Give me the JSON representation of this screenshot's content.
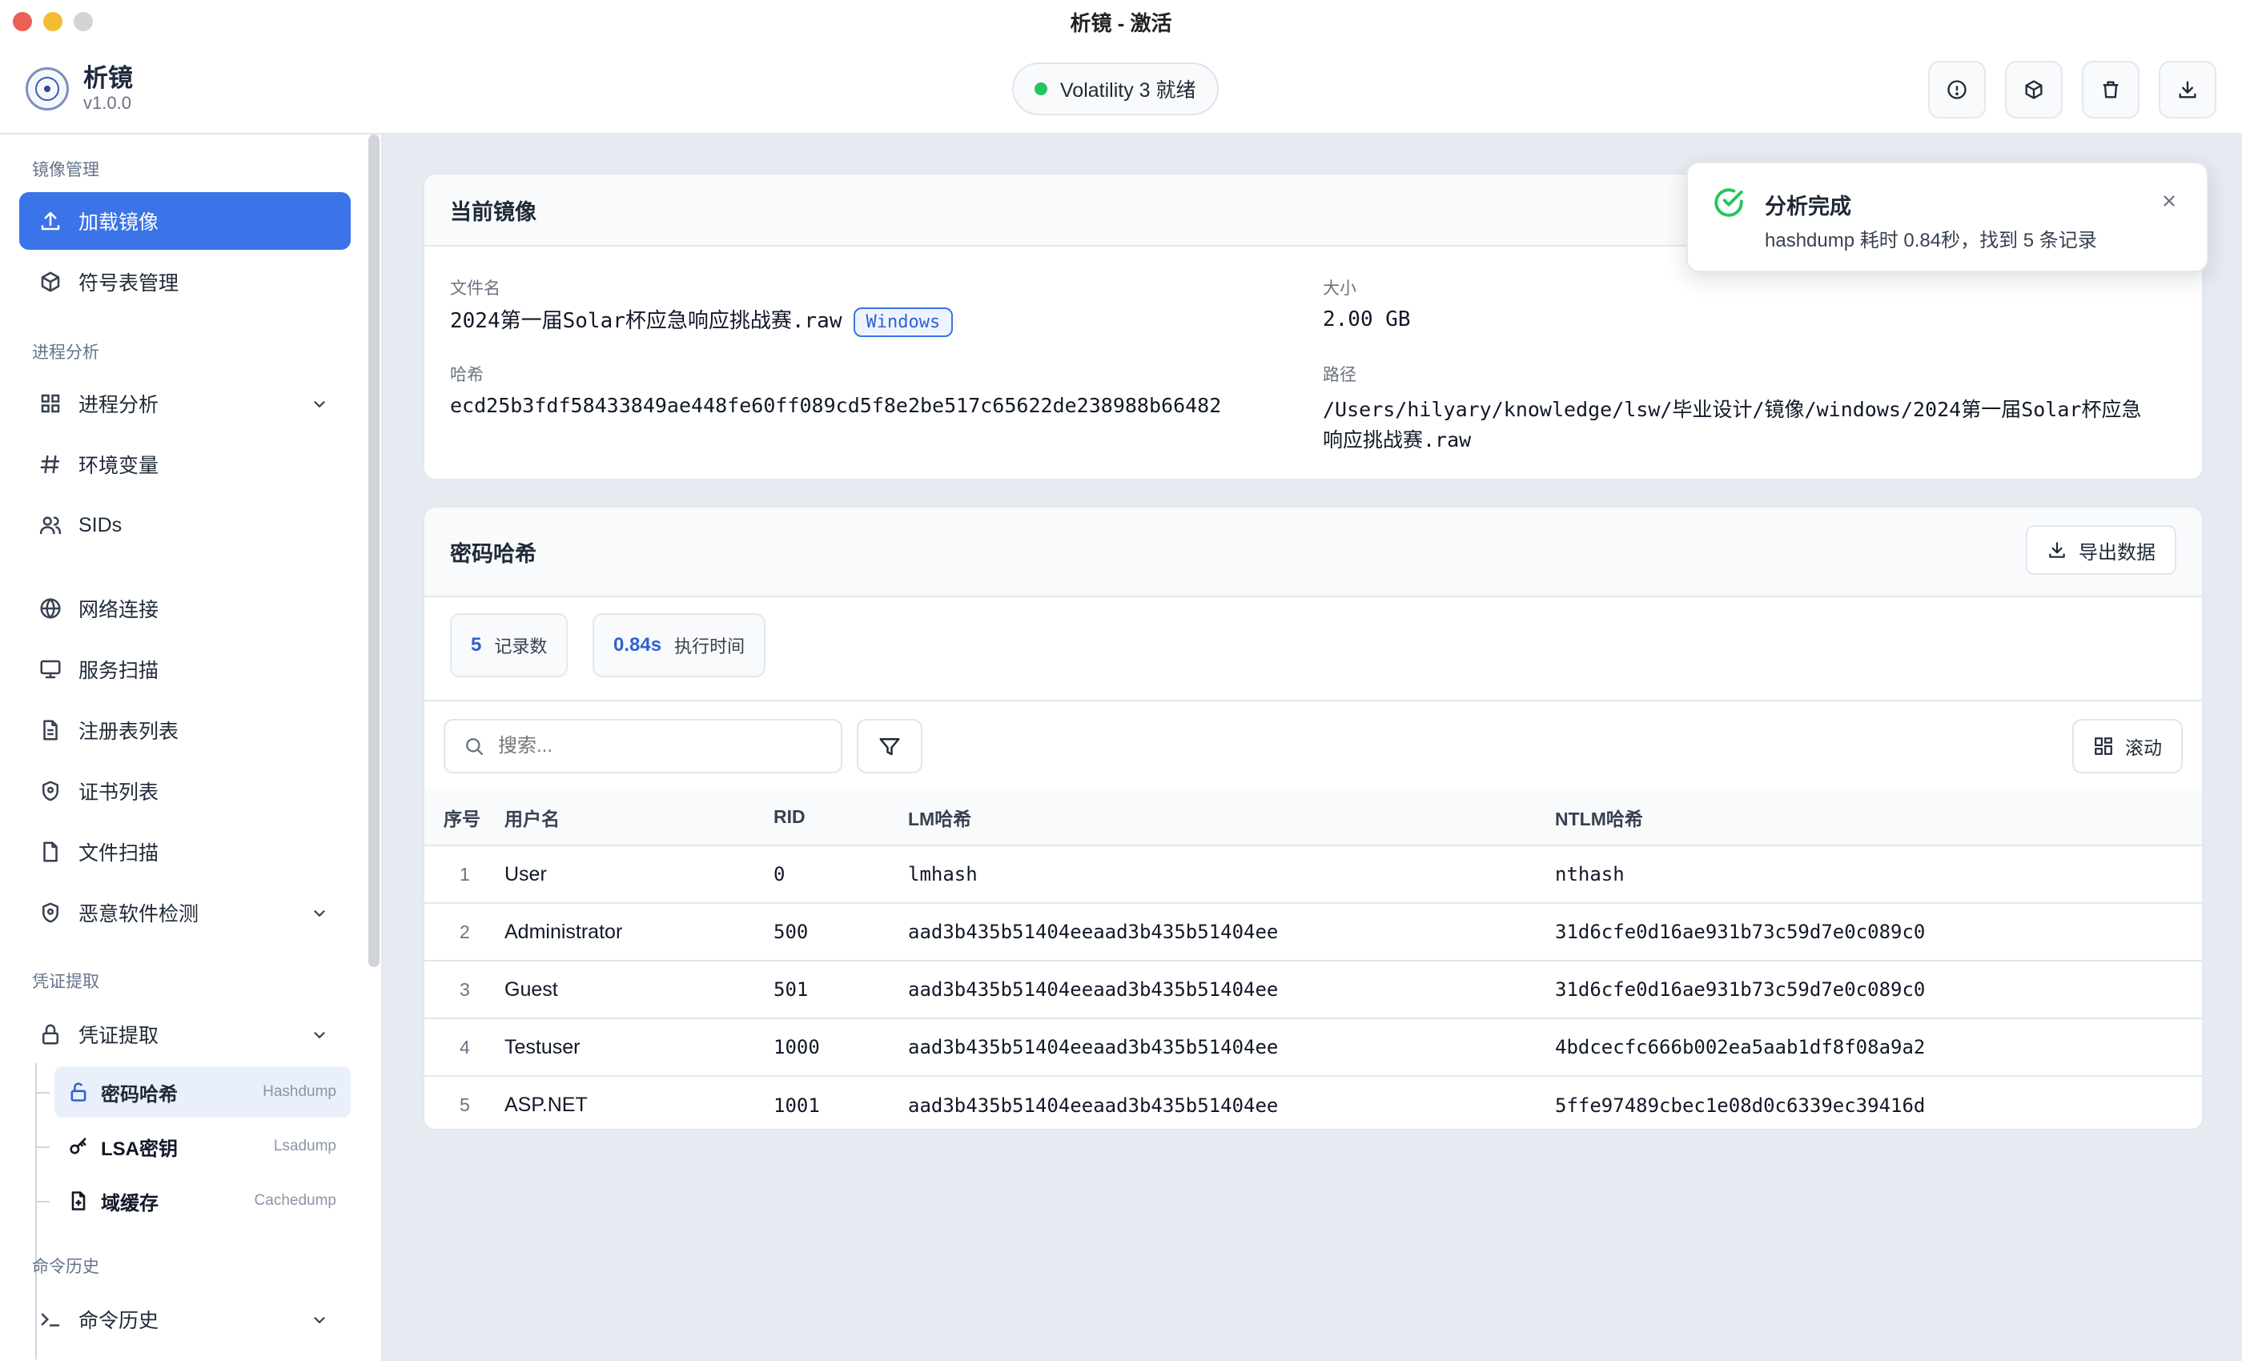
{
  "window": {
    "title": "析镜 - 激活"
  },
  "brand": {
    "name": "析镜",
    "version": "v1.0.0"
  },
  "status": {
    "text": "Volatility 3 就绪",
    "color": "#22c55e"
  },
  "header_buttons": [
    "info-icon",
    "cube-icon",
    "trash-icon",
    "download-icon"
  ],
  "sidebar": {
    "section_image": "镜像管理",
    "load_image": "加载镜像",
    "symbol_table": "符号表管理",
    "section_process": "进程分析",
    "process_analysis": "进程分析",
    "env_vars": "环境变量",
    "sids": "SIDs",
    "network": "网络连接",
    "service_scan": "服务扫描",
    "registry": "注册表列表",
    "certs": "证书列表",
    "file_scan": "文件扫描",
    "malware": "恶意软件检测",
    "section_cred": "凭证提取",
    "cred_extract": "凭证提取",
    "sub": [
      {
        "label": "密码哈希",
        "tag": "Hashdump"
      },
      {
        "label": "LSA密钥",
        "tag": "Lsadump"
      },
      {
        "label": "域缓存",
        "tag": "Cachedump"
      }
    ],
    "section_history": "命令历史",
    "history": "命令历史"
  },
  "image_card": {
    "title": "当前镜像",
    "filename_label": "文件名",
    "filename": "2024第一届Solar杯应急响应挑战赛.raw",
    "os_badge": "Windows",
    "size_label": "大小",
    "size": "2.00 GB",
    "hash_label": "哈希",
    "hash": "ecd25b3fdf58433849ae448fe60ff089cd5f8e2be517c65622de238988b66482",
    "path_label": "路径",
    "path_line1": "/Users/hilyary/knowledge/lsw/毕业设计/镜像/windows/2024第一届Solar杯应急",
    "path_line2": "响应挑战赛.raw"
  },
  "hash_card": {
    "title": "密码哈希",
    "export_label": "导出数据",
    "stats": {
      "records_value": "5",
      "records_label": "记录数",
      "time_value": "0.84s",
      "time_label": "执行时间"
    },
    "search_placeholder": "搜索...",
    "scroll_label": "滚动",
    "columns": [
      "序号",
      "用户名",
      "RID",
      "LM哈希",
      "NTLM哈希"
    ],
    "rows": [
      [
        "1",
        "User",
        "0",
        "lmhash",
        "nthash"
      ],
      [
        "2",
        "Administrator",
        "500",
        "aad3b435b51404eeaad3b435b51404ee",
        "31d6cfe0d16ae931b73c59d7e0c089c0"
      ],
      [
        "3",
        "Guest",
        "501",
        "aad3b435b51404eeaad3b435b51404ee",
        "31d6cfe0d16ae931b73c59d7e0c089c0"
      ],
      [
        "4",
        "Testuser",
        "1000",
        "aad3b435b51404eeaad3b435b51404ee",
        "4bdcecfc666b002ea5aab1df8f08a9a2"
      ],
      [
        "5",
        "ASP.NET",
        "1001",
        "aad3b435b51404eeaad3b435b51404ee",
        "5ffe97489cbec1e08d0c6339ec39416d"
      ]
    ]
  },
  "toast": {
    "title": "分析完成",
    "message": "hashdump 耗时 0.84秒，找到 5 条记录",
    "color": "#22c55e"
  },
  "colors": {
    "accent": "#3b73e8",
    "success": "#22c55e"
  }
}
